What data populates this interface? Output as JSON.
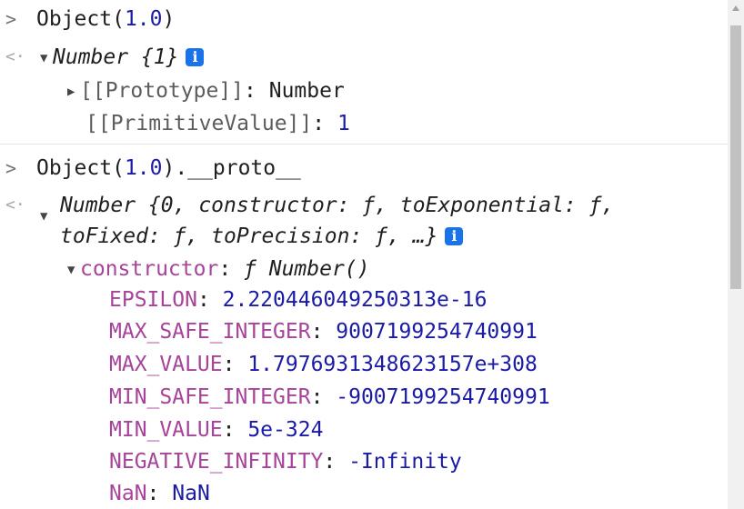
{
  "scrollbar": {
    "thumb_fraction": 0.52
  },
  "entries": {
    "first": {
      "prompt": ">",
      "input": {
        "call": "Object(",
        "arg": "1.0",
        "close": ")"
      },
      "result_arrow": "<·",
      "summary": {
        "text": "Number {1}"
      },
      "prototype": {
        "key": "[[Prototype]]",
        "sep": ": ",
        "value": "Number"
      },
      "primitive": {
        "key": "[[PrimitiveValue]]",
        "sep": ": ",
        "value": "1"
      }
    },
    "second": {
      "prompt": ">",
      "input": {
        "call": "Object(",
        "arg": "1.0",
        "rest": ").__proto__"
      },
      "result_arrow": "<·",
      "summary": {
        "line1": "Number {0, constructor: ƒ, toExponential: ƒ,",
        "line2": "toFixed: ƒ, toPrecision: ƒ, …}"
      },
      "constructor": {
        "key": "constructor",
        "sep": ": ",
        "value": "ƒ Number()"
      },
      "properties": [
        {
          "key": "EPSILON",
          "value": "2.220446049250313e-16"
        },
        {
          "key": "MAX_SAFE_INTEGER",
          "value": "9007199254740991"
        },
        {
          "key": "MAX_VALUE",
          "value": "1.7976931348623157e+308"
        },
        {
          "key": "MIN_SAFE_INTEGER",
          "value": "-9007199254740991"
        },
        {
          "key": "MIN_VALUE",
          "value": "5e-324"
        },
        {
          "key": "NEGATIVE_INFINITY",
          "value": "-Infinity"
        },
        {
          "key": "NaN",
          "value": "NaN"
        }
      ],
      "property_sep": ": "
    }
  },
  "icons": {
    "info": "info-icon",
    "expand": "triangle-down-icon",
    "collapse": "triangle-right-icon"
  },
  "colors": {
    "number": "#1a1aa6",
    "key": "#a7439a",
    "info_badge": "#1a73e8"
  }
}
